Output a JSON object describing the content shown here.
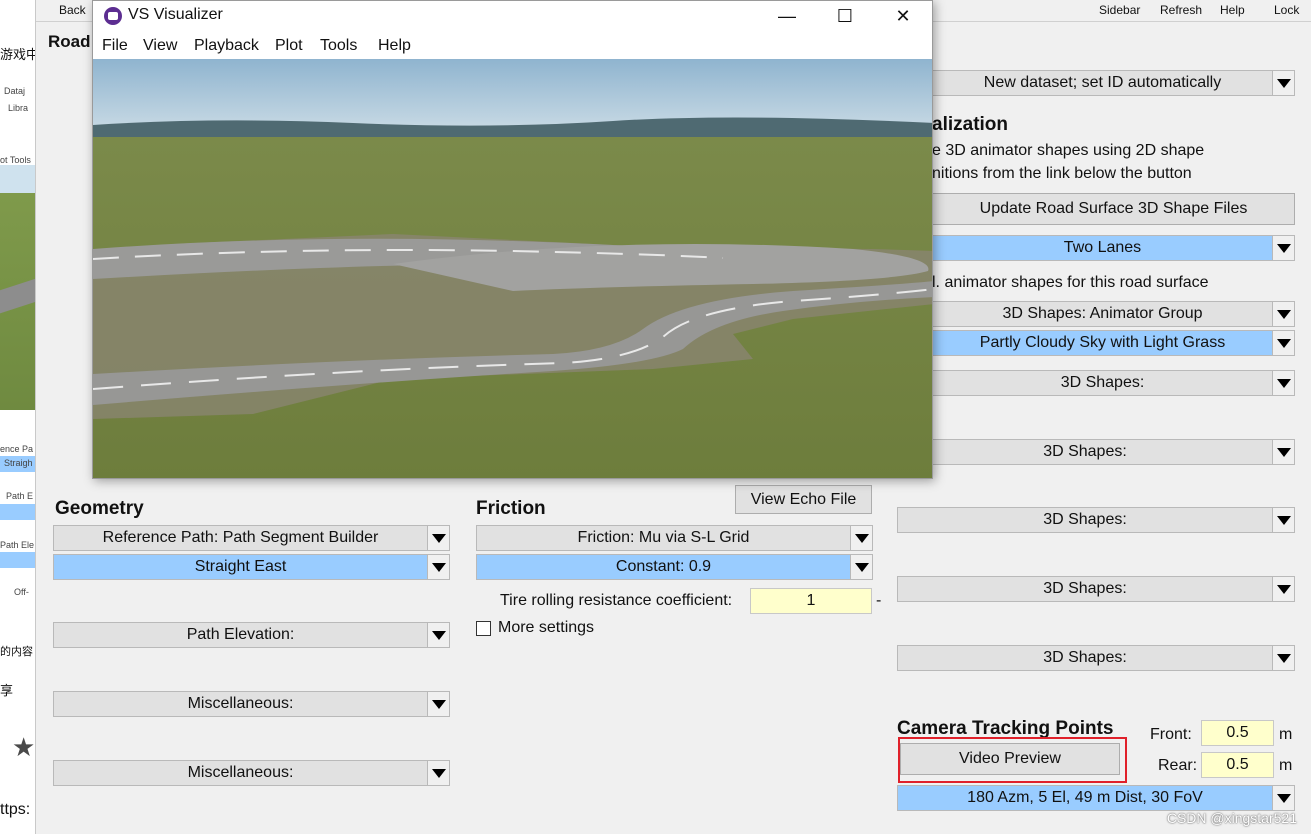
{
  "left_strip": {
    "text_1": "游戏中",
    "text_2": "Dataj",
    "text_3": "Libra",
    "text_4": "ot  Tools",
    "text_5": "ence Pa",
    "text_6": "Straigh",
    "text_7": "Path E",
    "text_8": "Path Ele",
    "text_9": "Off-",
    "text_10": "的内容",
    "text_11": "享",
    "text_12": "ttps:",
    "star_icon": "star-icon"
  },
  "toolbar": {
    "back": "Back",
    "sidebar": "Sidebar",
    "refresh": "Refresh",
    "help": "Help",
    "lock": "Lock"
  },
  "road_tab": "Road",
  "visualizer": {
    "title": "VS Visualizer",
    "menu": [
      "File",
      "View",
      "Playback",
      "Plot",
      "Tools",
      "Help"
    ]
  },
  "right_panel": {
    "dataset_dropdown": "New dataset; set ID automatically",
    "visualization_heading": "alization",
    "description_line1": "e 3D animator shapes using 2D shape",
    "description_line2": "nitions from the link below the button",
    "update_button": "Update Road Surface 3D Shape Files",
    "lanes_dropdown": "Two Lanes",
    "animator_label": "l. animator shapes for this road surface",
    "animator_group_dropdown": "3D Shapes: Animator Group",
    "sky_dropdown": "Partly Cloudy Sky with Light Grass",
    "shape_dropdowns": [
      "3D Shapes:",
      "3D Shapes:",
      "3D Shapes:",
      "3D Shapes:",
      "3D Shapes:"
    ]
  },
  "geometry": {
    "heading": "Geometry",
    "reference_path": "Reference Path: Path Segment Builder",
    "straight_east": "Straight East",
    "path_elevation": "Path Elevation:",
    "misc_1": "Miscellaneous:",
    "misc_2": "Miscellaneous:"
  },
  "friction": {
    "heading": "Friction",
    "view_echo": "View Echo File",
    "mu_dropdown": "Friction: Mu via S-L Grid",
    "constant": "Constant: 0.9",
    "tire_label": "Tire rolling resistance coefficient:",
    "tire_value": "1",
    "tire_unit": "-",
    "more_settings": "More settings"
  },
  "camera": {
    "heading": "Camera Tracking Points",
    "video_preview": "Video Preview",
    "front_label": "Front:",
    "front_value": "0.5",
    "front_unit": "m",
    "rear_label": "Rear:",
    "rear_value": "0.5",
    "rear_unit": "m",
    "view_dropdown": "180 Azm, 5 El, 49 m Dist, 30 FoV"
  },
  "watermark": "CSDN @xingstar521",
  "colors": {
    "dropdown_blue": "#99ccff",
    "field_yellow": "#ffffcc",
    "highlight_red": "#e0202a",
    "button_gray": "#e1e1e1",
    "panel_bg": "#f0f0f0"
  }
}
